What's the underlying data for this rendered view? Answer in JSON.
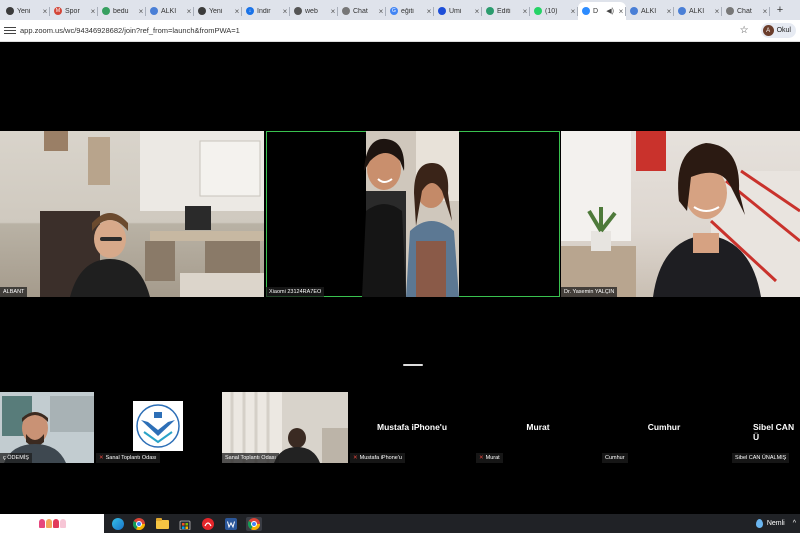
{
  "tabs": [
    {
      "label": "Yeni",
      "fav_color": "#3b3b3b",
      "active": false
    },
    {
      "label": "Spor",
      "fav_color": "#d44638",
      "fav_glyph": "M",
      "active": false
    },
    {
      "label": "bedu",
      "fav_color": "#37a060",
      "active": false
    },
    {
      "label": "ALKI",
      "fav_color": "#4a7fd6",
      "active": false
    },
    {
      "label": "Yeni",
      "fav_color": "#3b3b3b",
      "active": false
    },
    {
      "label": "İndir",
      "fav_color": "#1a73e8",
      "fav_glyph": "↓",
      "active": false
    },
    {
      "label": "web",
      "fav_color": "#555555",
      "active": false
    },
    {
      "label": "Chat",
      "fav_color": "#777777",
      "active": false
    },
    {
      "label": "eğiti",
      "fav_color": "#4285f4",
      "fav_glyph": "G",
      "active": false
    },
    {
      "label": "Umi",
      "fav_color": "#1d4ed8",
      "active": false
    },
    {
      "label": "Editi",
      "fav_color": "#2b9c6e",
      "active": false
    },
    {
      "label": "(10)",
      "fav_color": "#25d366",
      "active": false
    },
    {
      "label": "D",
      "fav_color": "#2d8cff",
      "active": true
    },
    {
      "label": "ALKI",
      "fav_color": "#4a7fd6",
      "active": false
    },
    {
      "label": "ALKI",
      "fav_color": "#4a7fd6",
      "active": false
    },
    {
      "label": "Chat",
      "fav_color": "#777777",
      "active": false
    }
  ],
  "address": {
    "url": "app.zoom.us/wc/94346928682/join?ref_from=launch&fromPWA=1",
    "profile_initial": "A",
    "profile_label": "Okul"
  },
  "main_tiles": [
    {
      "name": "ALBANT"
    },
    {
      "name": "Xiaomi 23124RA7EO"
    },
    {
      "name": "Dr. Yasemin YALÇIN"
    }
  ],
  "strip_tiles": [
    {
      "name": "ç ÖDEMİŞ",
      "muted": false
    },
    {
      "name": "Sanal Toplantı Odası",
      "muted": true
    },
    {
      "name": "Sanal Toplantı Odası",
      "muted": false
    },
    {
      "name": "Mustafa iPhone'u",
      "muted": true,
      "big": "Mustafa iPhone'u"
    },
    {
      "name": "Murat",
      "muted": true,
      "big": "Murat"
    },
    {
      "name": "Cumhur",
      "muted": false,
      "big": "Cumhur"
    },
    {
      "name": "Sibel CAN ÜNALMIŞ",
      "muted": false,
      "big": "Sibel CAN Ü"
    }
  ],
  "taskbar": {
    "weather": "Nemli"
  },
  "colors": {
    "speaking_border": "#39c14f",
    "zoom_blue": "#2d8cff"
  }
}
